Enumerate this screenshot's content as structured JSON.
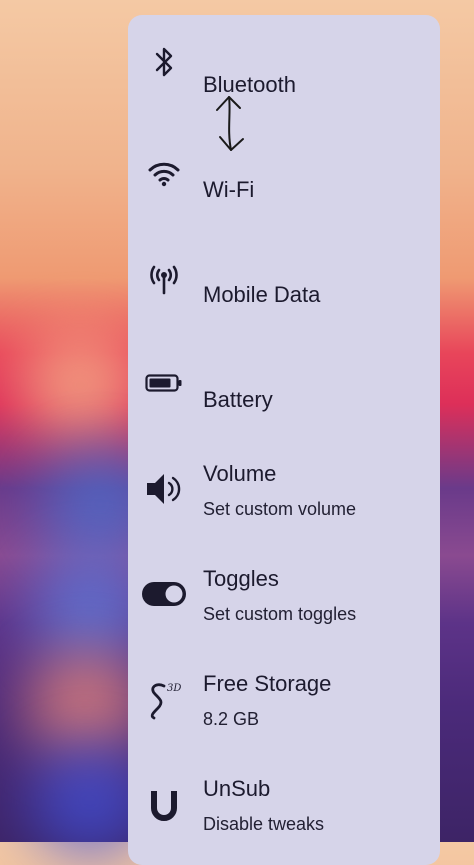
{
  "menu": {
    "items": [
      {
        "label": "Bluetooth",
        "icon": "bluetooth-icon"
      },
      {
        "label": "Wi-Fi",
        "icon": "wifi-icon"
      },
      {
        "label": "Mobile Data",
        "icon": "antenna-icon"
      },
      {
        "label": "Battery",
        "icon": "battery-icon"
      },
      {
        "label": "Volume",
        "sub": "Set custom volume",
        "icon": "speaker-icon"
      },
      {
        "label": "Toggles",
        "sub": "Set custom toggles",
        "icon": "toggle-icon"
      },
      {
        "label": "Free Storage",
        "sub": "8.2 GB",
        "icon": "storage-icon"
      },
      {
        "label": "UnSub",
        "sub": "Disable tweaks",
        "icon": "unsub-icon"
      }
    ]
  },
  "colors": {
    "panel": "#d6d4e9",
    "text": "#1c1a2e"
  }
}
